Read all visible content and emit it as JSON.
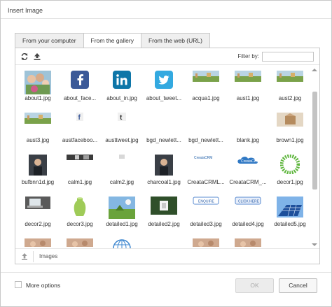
{
  "dialog": {
    "title": "Insert Image"
  },
  "tabs": [
    {
      "label": "From your computer"
    },
    {
      "label": "From the gallery",
      "active": true
    },
    {
      "label": "From the web (URL)"
    }
  ],
  "toolbar": {
    "filter_label": "Filter by:",
    "filter_value": "",
    "refresh_icon": "refresh-icon",
    "upload_icon": "upload-icon"
  },
  "items": [
    {
      "caption": "about1.jpg",
      "icon": "photo-people"
    },
    {
      "caption": "about_face...",
      "icon": "facebook-logo"
    },
    {
      "caption": "about_in.jpg",
      "icon": "linkedin-logo"
    },
    {
      "caption": "about_tweet...",
      "icon": "twitter-logo"
    },
    {
      "caption": "acqua1.jpg",
      "icon": "photo-landscape"
    },
    {
      "caption": "aust1.jpg",
      "icon": "photo-landscape"
    },
    {
      "caption": "aust2.jpg",
      "icon": "photo-landscape"
    },
    {
      "caption": "aust3.jpg",
      "icon": "photo-landscape"
    },
    {
      "caption": "austfaceboo...",
      "icon": "facebook-small"
    },
    {
      "caption": "austtweet.jpg",
      "icon": "twitter-small"
    },
    {
      "caption": "bgd_newlett...",
      "icon": "blank"
    },
    {
      "caption": "bgd_newlett...",
      "icon": "blank"
    },
    {
      "caption": "blank.jpg",
      "icon": "blank"
    },
    {
      "caption": "brown1.jpg",
      "icon": "photo-box"
    },
    {
      "caption": "bufbnn1d.jpg",
      "icon": "photo-person"
    },
    {
      "caption": "calm1.jpg",
      "icon": "photo-strip"
    },
    {
      "caption": "calm2.jpg",
      "icon": "photo-small"
    },
    {
      "caption": "charcoal1.jpg",
      "icon": "photo-person"
    },
    {
      "caption": "CreataCRML...",
      "icon": "logo-text"
    },
    {
      "caption": "CreataCRM_...",
      "icon": "logo-cloud"
    },
    {
      "caption": "decor1.jpg",
      "icon": "decor-circle"
    },
    {
      "caption": "decor2.jpg",
      "icon": "photo-laptop"
    },
    {
      "caption": "decor3.jpg",
      "icon": "photo-vase"
    },
    {
      "caption": "detailed1.jpg",
      "icon": "photo-field"
    },
    {
      "caption": "detailed2.jpg",
      "icon": "photo-frame"
    },
    {
      "caption": "detailed3.jpg",
      "icon": "button-enquire"
    },
    {
      "caption": "detailed4.jpg",
      "icon": "button-click"
    },
    {
      "caption": "detailed5.jpg",
      "icon": "photo-solar"
    },
    {
      "caption": "",
      "icon": "photo-partial"
    },
    {
      "caption": "",
      "icon": "photo-partial"
    },
    {
      "caption": "",
      "icon": "globe"
    },
    {
      "caption": "",
      "icon": "blank"
    },
    {
      "caption": "",
      "icon": "photo-partial"
    },
    {
      "caption": "",
      "icon": "photo-partial"
    }
  ],
  "status": {
    "icon": "upload-icon",
    "text": "Images"
  },
  "footer": {
    "more_options_label": "More options",
    "more_options_checked": false,
    "ok_label": "OK",
    "cancel_label": "Cancel"
  },
  "colors": {
    "facebook": "#3b5998",
    "linkedin": "#0e76a8",
    "twitter": "#33a9e0",
    "ok_disabled": "#ececec"
  }
}
